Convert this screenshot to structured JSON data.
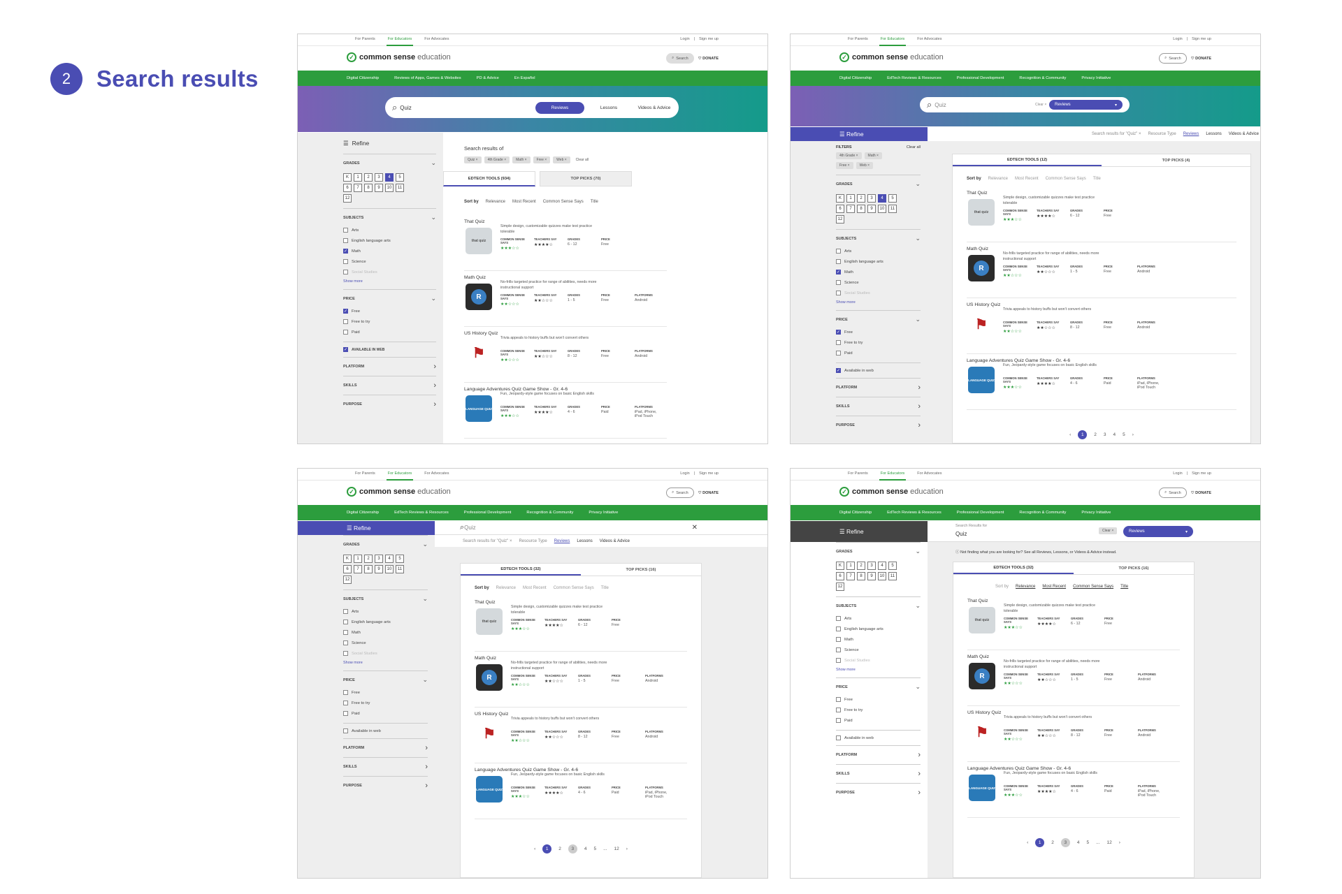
{
  "step": {
    "number": "2",
    "title": "Search results"
  },
  "header": {
    "audiences": [
      "For Parents",
      "For Educators",
      "For Advocates"
    ],
    "login": "Login",
    "signup": "Sign me up",
    "logo_bold": "common sense",
    "logo_light": "education",
    "search": "Search",
    "donate": "DONATE"
  },
  "nav_v1": [
    "Digital Citizenship",
    "Reviews of Apps, Games & Websites",
    "PD & Advice",
    "En Español"
  ],
  "nav_v2": [
    "Digital Citizenship",
    "EdTech Reviews & Resources",
    "Professional Development",
    "Recognition & Community",
    "Privacy Initiative"
  ],
  "search": {
    "query": "Quiz",
    "tabs": [
      "Reviews",
      "Lessons",
      "Videos & Advice"
    ],
    "clear": "Clear",
    "results_of": "Search results of",
    "results_for": "Search results for",
    "results_for_caps": "Search Results for",
    "resource_type": "Resource Type",
    "clear_all": "Clear all",
    "not_finding": "Not finding what you are looking for? See all Reviews, Lessons, or Videos & Advice instead."
  },
  "filters": {
    "refine": "Refine",
    "filters_label": "FILTERS",
    "active": [
      "Quiz",
      "4th Grade",
      "Math",
      "Free",
      "Web"
    ],
    "active_short": [
      "4th Grade",
      "Math",
      "Free",
      "Web"
    ],
    "grades_label": "GRADES",
    "grades": [
      "K",
      "1",
      "2",
      "3",
      "4",
      "5",
      "6",
      "7",
      "8",
      "9",
      "10",
      "11",
      "12"
    ],
    "subjects_label": "SUBJECTS",
    "subjects": [
      "Arts",
      "English language arts",
      "Math",
      "Science",
      "Social Studies"
    ],
    "show_more": "Show more",
    "price_label": "PRICE",
    "prices": [
      "Free",
      "Free to try",
      "Paid"
    ],
    "web_caps": "AVAILABLE IN WEB",
    "web": "Available in web",
    "platform": "PLATFORM",
    "skills": "SKILLS",
    "purpose": "PURPOSE"
  },
  "results": {
    "tab_edtech_v1": "EDTECH TOOLS (934)",
    "tab_picks_v1": "TOP PICKS (70)",
    "tab_edtech": "EDTECH TOOLS (32)",
    "tab_picks": "TOP PICKS (16)",
    "tab_edtech_b": "EDTECH TOOLS (12)",
    "tab_picks_b": "TOP PICKS (4)",
    "sort_by": "Sort by",
    "sort_options": [
      "Relevance",
      "Most Recent",
      "Common Sense Says",
      "Title"
    ],
    "labels": {
      "cs": "COMMON SENSE SAYS",
      "ts": "TEACHERS SAY",
      "grades": "GRADES",
      "price": "PRICE",
      "platforms": "PLATFORMS"
    },
    "items": [
      {
        "title": "That Quiz",
        "desc": "Simple design, customizable quizzes make test practice tolerable",
        "cs": "★★★☆☆",
        "ts": "★★★★☆",
        "grades": "6 - 12",
        "price": "Free",
        "platforms": "",
        "icon": "thatquiz"
      },
      {
        "title": "Math Quiz",
        "desc": "No-frills targeted practice for range of abilities, needs more instructional support",
        "cs": "★★☆☆☆",
        "ts": "★★☆☆☆",
        "grades": "1 - 5",
        "price": "Free",
        "platforms": "Android",
        "icon": "R"
      },
      {
        "title": "US History Quiz",
        "desc": "Trivia appeals to history buffs but won't convert others",
        "cs": "★★☆☆☆",
        "ts": "★★☆☆☆",
        "grades": "8 - 12",
        "price": "Free",
        "platforms": "Android",
        "icon": "flag"
      },
      {
        "title": "Language Adventures Quiz Game Show - Gr. 4-6",
        "desc": "Fun, Jeopardy-style game focuses on basic English skills",
        "cs": "★★★☆☆",
        "ts": "★★★★☆",
        "grades": "4 - 6",
        "price": "Paid",
        "platforms": "iPad, iPhone, iPod Touch",
        "icon": "LANGUAGE QUIZ"
      }
    ]
  },
  "pager_a": [
    "1",
    "2",
    "3",
    "4",
    "5"
  ],
  "pager_b": [
    "1",
    "2",
    "3",
    "4",
    "5",
    "...",
    "12"
  ]
}
